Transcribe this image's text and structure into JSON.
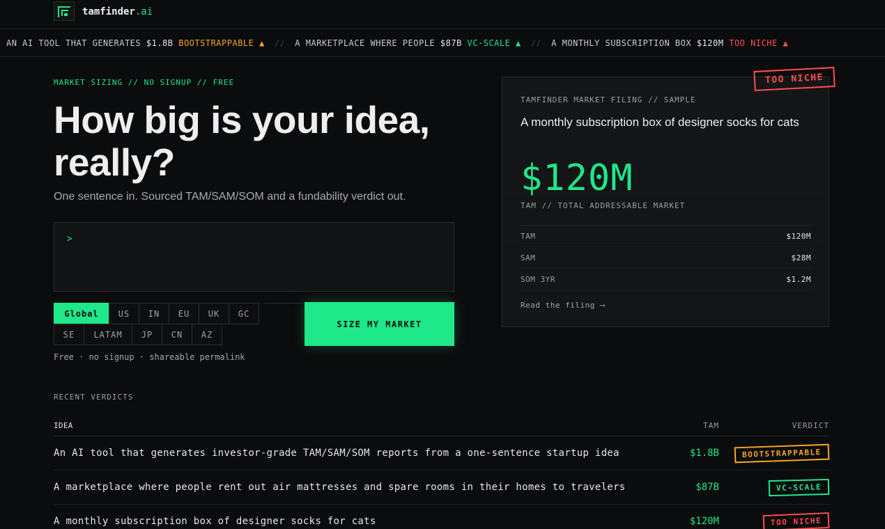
{
  "nav": {
    "brand": "tamfinder",
    "brand_suffix": ".ai"
  },
  "ticker": [
    {
      "text": "AN AI TOOL THAT GENERATES",
      "value": "$1.8B",
      "verdict": "BOOTSTRAPPABLE",
      "arrow": "▲",
      "color": "#f5a524"
    },
    {
      "text": "A MARKETPLACE WHERE PEOPLE",
      "value": "$87B",
      "verdict": "VC-SCALE",
      "arrow": "▲",
      "color": "#1ee88a"
    },
    {
      "text": "A MONTHLY SUBSCRIPTION BOX",
      "value": "$120M",
      "verdict": "TOO NICHE",
      "arrow": "▲",
      "color": "#ff4d4f"
    }
  ],
  "ticker_sep": "//",
  "hero": {
    "eyebrow": "MARKET SIZING // NO SIGNUP // FREE",
    "headline": "How big is your idea, really?",
    "subhead": "One sentence in. Sourced TAM/SAM/SOM and a fundability verdict out.",
    "input_prompt": ">",
    "input_value": "",
    "regions_row1": [
      "Global",
      "US",
      "IN",
      "EU",
      "UK",
      "GC"
    ],
    "regions_row2": [
      "SE",
      "LATAM",
      "JP",
      "CN",
      "AZ"
    ],
    "selected_region": "Global",
    "submit_label": "SIZE MY MARKET",
    "fineprint": "Free · no signup · shareable permalink"
  },
  "card": {
    "eyebrow": "TAMFINDER MARKET FILING // SAMPLE",
    "title": "A monthly subscription box of designer socks for cats",
    "big_value": "$120M",
    "big_label": "TAM // TOTAL ADDRESSABLE MARKET",
    "rows": [
      {
        "label": "TAM",
        "value": "$120M"
      },
      {
        "label": "SAM",
        "value": "$28M"
      },
      {
        "label": "SOM 3YR",
        "value": "$1.2M"
      }
    ],
    "link": "Read the filing ⟶",
    "stamp": "TOO NICHE"
  },
  "recent": {
    "title": "RECENT VERDICTS",
    "headers": {
      "idea": "IDEA",
      "tam": "TAM",
      "verdict": "VERDICT"
    },
    "rows": [
      {
        "idea": "An AI tool that generates investor-grade TAM/SAM/SOM reports from a one-sentence startup idea",
        "tam": "$1.8B",
        "verdict": "BOOTSTRAPPABLE",
        "tone": "amber"
      },
      {
        "idea": "A marketplace where people rent out air mattresses and spare rooms in their homes to travelers",
        "tam": "$87B",
        "verdict": "VC-SCALE",
        "tone": "green"
      },
      {
        "idea": "A monthly subscription box of designer socks for cats",
        "tam": "$120M",
        "verdict": "TOO NICHE",
        "tone": "red"
      }
    ]
  },
  "colors": {
    "accent": "#1ee88a",
    "amber": "#f5a524",
    "red": "#ff4d4f",
    "background": "#0b0c0d"
  }
}
